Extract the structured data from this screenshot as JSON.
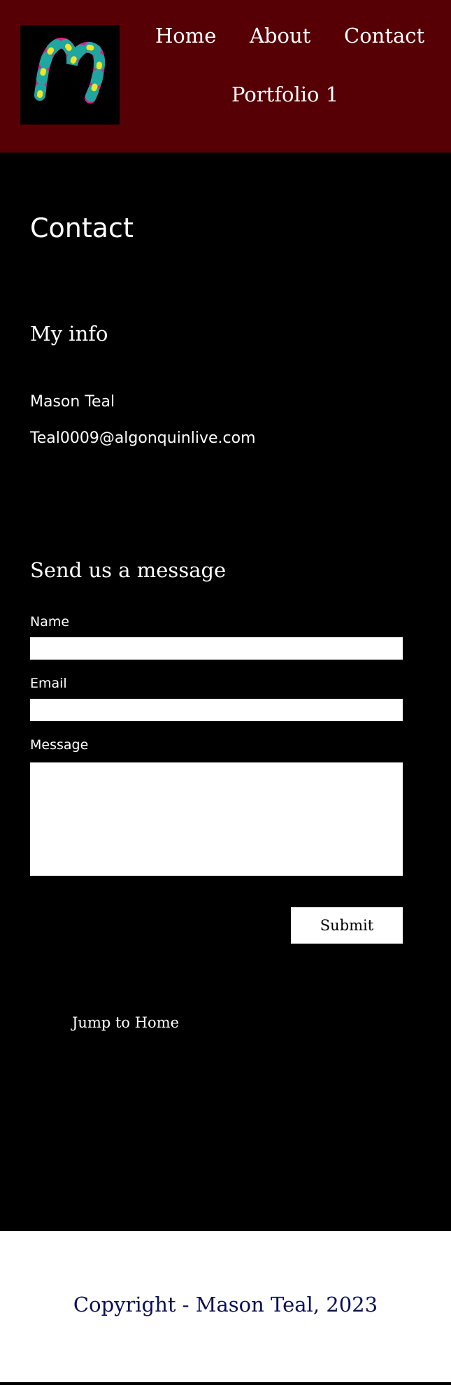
{
  "header": {
    "logo_icon": "m-logo-icon",
    "nav": [
      "Home",
      "About",
      "Contact",
      "Portfolio 1"
    ]
  },
  "main": {
    "page_title": "Contact",
    "info_title": "My info",
    "info_name": "Mason Teal",
    "info_email": "Teal0009@algonquinlive.com",
    "message_title": "Send us a message",
    "form": {
      "name_label": "Name",
      "name_value": "",
      "email_label": "Email",
      "email_value": "",
      "message_label": "Message",
      "message_value": "",
      "submit_label": "Submit"
    },
    "jump_link": "Jump to Home"
  },
  "footer": {
    "copyright": "Copyright - Mason Teal, 2023"
  },
  "colors": {
    "header_bg": "#560005",
    "page_bg": "#000000",
    "footer_bg": "#ffffff",
    "footer_text": "#0a0f56"
  }
}
